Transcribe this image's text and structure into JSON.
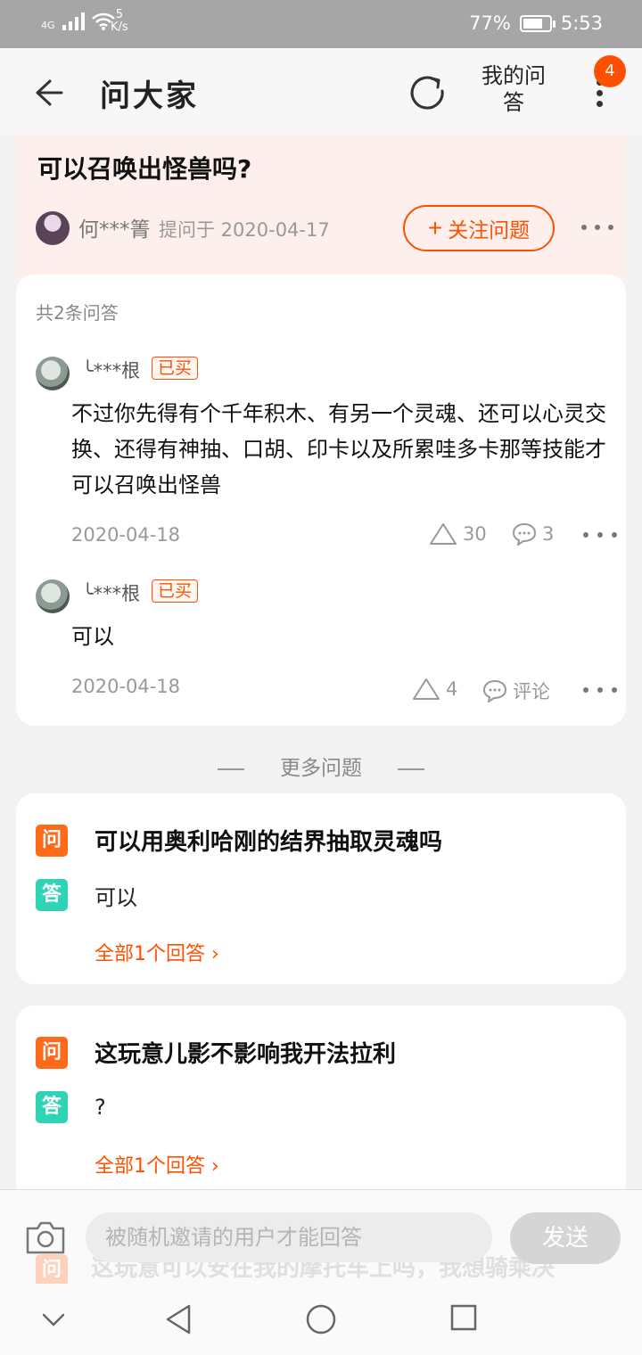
{
  "status_bar": {
    "network": "4G",
    "speed_value": "5",
    "speed_unit": "K/s",
    "battery": "77%",
    "battery_level": 0.77,
    "time": "5:53"
  },
  "header": {
    "title": "问大家",
    "my_qa": "我的问答",
    "badge": "4"
  },
  "question": {
    "title": "可以召唤出怪兽吗?",
    "asker": "何***箐",
    "asked_at": "提问于 2020-04-17",
    "follow_label": "关注问题"
  },
  "answers": {
    "count_label": "共2条问答",
    "items": [
      {
        "user": "╰***根",
        "badge": "已买",
        "text": "不过你先得有个千年积木、有另一个灵魂、还可以心灵交换、还得有神抽、口胡、印卡以及所累哇多卡那等技能才可以召唤出怪兽",
        "date": "2020-04-18",
        "likes": "30",
        "comments": "3"
      },
      {
        "user": "╰***根",
        "badge": "已买",
        "text": "可以",
        "date": "2020-04-18",
        "likes": "4",
        "comments": "评论"
      }
    ]
  },
  "more_questions": {
    "heading": "更多问题",
    "q_tag": "问",
    "a_tag": "答",
    "items": [
      {
        "question": "可以用奥利哈刚的结界抽取灵魂吗",
        "answer": "可以",
        "all_answers": "全部1个回答"
      },
      {
        "question": "这玩意儿影不影响我开法拉利",
        "answer": "?",
        "all_answers": "全部1个回答"
      }
    ],
    "partial_question": "这玩意可以安在我的摩托车上吗，我想骑乘决"
  },
  "input_bar": {
    "placeholder": "被随机邀请的用户才能回答",
    "send_label": "发送"
  }
}
